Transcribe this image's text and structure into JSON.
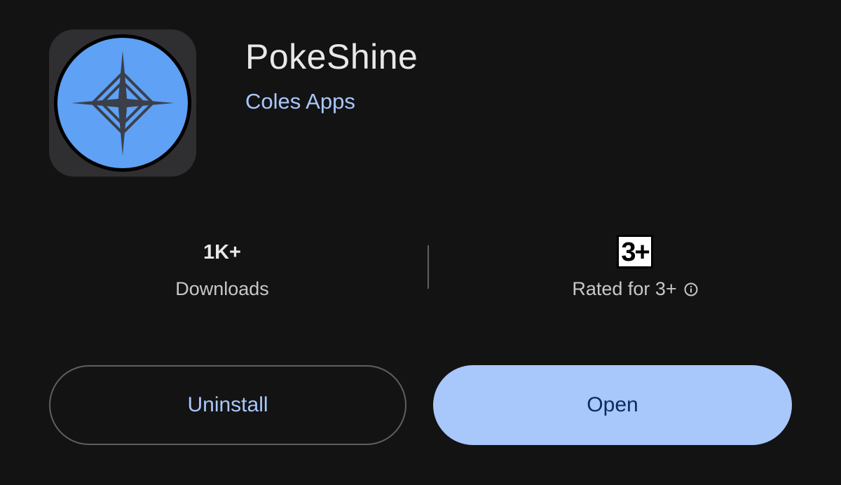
{
  "app": {
    "name": "PokeShine",
    "developer": "Coles Apps",
    "icon": "pokeshine-logo-icon"
  },
  "stats": {
    "downloads": {
      "value": "1K+",
      "label": "Downloads"
    },
    "rating": {
      "badge": "3+",
      "label": "Rated for 3+",
      "info_icon": "info-icon"
    }
  },
  "actions": {
    "uninstall_label": "Uninstall",
    "open_label": "Open"
  },
  "colors": {
    "background": "#131314",
    "accent": "#a8c7fa",
    "icon_blue": "#5ea1f5"
  }
}
